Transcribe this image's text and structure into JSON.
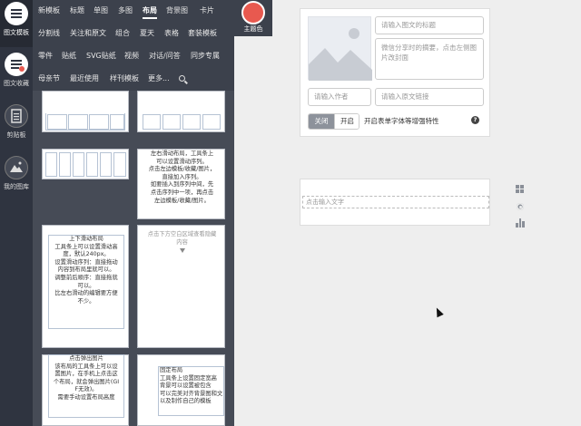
{
  "rail": [
    {
      "label": "图文模板",
      "icon": "list-icon",
      "active": true
    },
    {
      "label": "图文收藏",
      "icon": "favorite-list-icon",
      "active": false
    },
    {
      "label": "剪贴板",
      "icon": "clipboard-icon",
      "active": false
    },
    {
      "label": "我的图库",
      "icon": "gallery-icon",
      "active": false
    }
  ],
  "nav": {
    "row1": [
      "新模板",
      "标题",
      "单图",
      "多图",
      "布局",
      "背景图",
      "卡片"
    ],
    "row2": [
      "分割线",
      "关注和原文",
      "组合",
      "夏天",
      "表格",
      "套装模板"
    ],
    "row3": [
      "零件",
      "贴纸",
      "SVG贴纸",
      "视频",
      "对话/问答",
      "同步专属"
    ],
    "row4": [
      "母亲节",
      "最近使用",
      "样刊模板",
      "更多..."
    ],
    "active": "布局",
    "search_icon": "search-icon"
  },
  "theme": {
    "label": "主题色",
    "color": "#e8594f"
  },
  "cards": {
    "c4_lines": [
      "左右滑动布局，工具条上",
      "可以设置滑动序列。",
      "点击左边模板/收藏/图片，",
      "直接加入序列。",
      "如要插入到序列中间，先",
      "点击序列中一项，再点击",
      "左边模板/收藏/图片。"
    ],
    "c5_lines": [
      "上下滑动布局",
      "工具条上可以设置滑动高",
      "度，默认240px。",
      "设置滑动序列：直接拖动",
      "内容到布局里就可以。",
      "调整前后顺序：直接拖就",
      "可以。",
      "比左右滑动的编辑要方便",
      "不少。"
    ],
    "c6_lines": [
      "点击下方空白区域查看隐藏",
      "内容"
    ],
    "c7_lines": [
      "点击弹出图片",
      "该布局的工具条上可以设",
      "置图片，在手机上点击这",
      "个布局，就会弹出图片(GI",
      "F无效)。",
      "需要手动设置布局高度"
    ],
    "c8_lines": [
      "固定布局",
      "工具条上设置固定宽高",
      "背景可以设置被包含",
      "可以完美对齐背景图和文",
      "以及制作自己的模板"
    ]
  },
  "editor": {
    "title_placeholder": "请输入图文的标题",
    "summary_placeholder": "微信分享时的摘要，点击左侧图片改封面",
    "author_placeholder": "请输入作者",
    "source_placeholder": "请输入原文链接",
    "toggle_off": "关闭",
    "toggle_on": "开启",
    "toggle_text": "开启表单字体等增强特性",
    "help_glyph": "?",
    "text_placeholder": "点击输入文字"
  },
  "side_icons": [
    "grid-icon",
    "gear-icon",
    "bar-chart-icon"
  ]
}
